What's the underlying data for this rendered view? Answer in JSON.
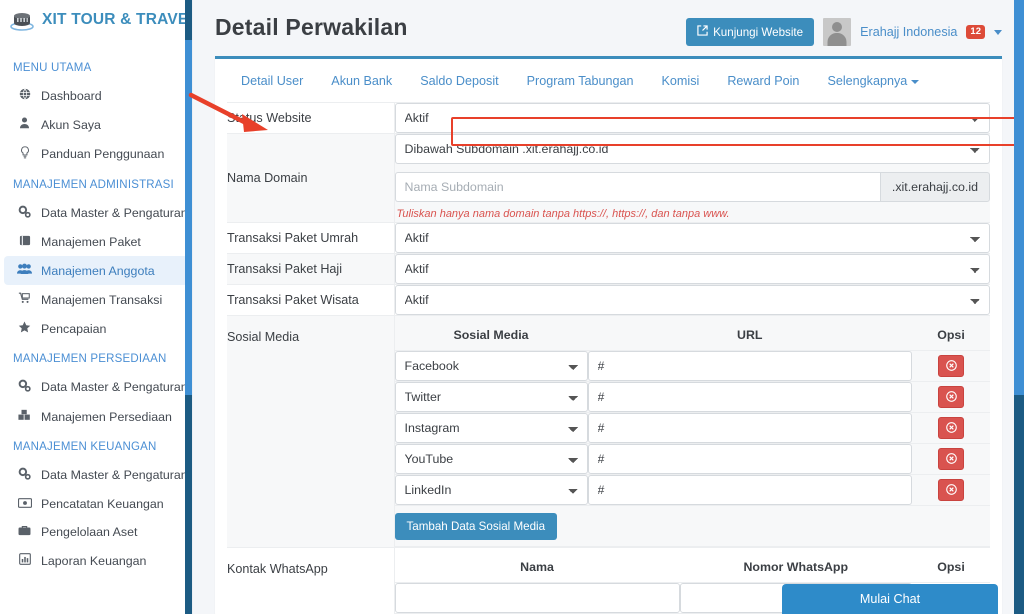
{
  "brand": {
    "name": "XIT TOUR & TRAVEL",
    "logo_icon": "stack-logo-icon"
  },
  "sidebar": {
    "groups": [
      {
        "header": "MENU UTAMA",
        "items": [
          {
            "label": "Dashboard",
            "icon": "globe-icon",
            "active": false
          },
          {
            "label": "Akun Saya",
            "icon": "user-icon",
            "active": false
          },
          {
            "label": "Panduan Penggunaan",
            "icon": "lightbulb-icon",
            "active": false
          }
        ]
      },
      {
        "header": "MANAJEMEN ADMINISTRASI",
        "items": [
          {
            "label": "Data Master & Pengaturan",
            "icon": "gears-icon",
            "active": false
          },
          {
            "label": "Manajemen Paket",
            "icon": "book-icon",
            "active": false
          },
          {
            "label": "Manajemen Anggota",
            "icon": "users-icon",
            "active": true
          },
          {
            "label": "Manajemen Transaksi",
            "icon": "cart-icon",
            "active": false
          },
          {
            "label": "Pencapaian",
            "icon": "star-icon",
            "active": false
          }
        ]
      },
      {
        "header": "MANAJEMEN PERSEDIAAN",
        "items": [
          {
            "label": "Data Master & Pengaturan",
            "icon": "gears-icon",
            "active": false
          },
          {
            "label": "Manajemen Persediaan",
            "icon": "boxes-icon",
            "active": false
          }
        ]
      },
      {
        "header": "MANAJEMEN KEUANGAN",
        "items": [
          {
            "label": "Data Master & Pengaturan",
            "icon": "gears-icon",
            "active": false
          },
          {
            "label": "Pencatatan Keuangan",
            "icon": "money-icon",
            "active": false
          },
          {
            "label": "Pengelolaan Aset",
            "icon": "briefcase-icon",
            "active": false
          },
          {
            "label": "Laporan Keuangan",
            "icon": "report-icon",
            "active": false
          }
        ]
      }
    ]
  },
  "header": {
    "page_title": "Detail Perwakilan",
    "visit_button": "Kunjungi Website",
    "visit_icon": "external-link-icon",
    "user_name": "Erahajj Indonesia",
    "notification_count": "12",
    "caret_icon": "chevron-down-icon"
  },
  "tabs": [
    {
      "label": "Detail User"
    },
    {
      "label": "Akun Bank"
    },
    {
      "label": "Saldo Deposit"
    },
    {
      "label": "Program Tabungan"
    },
    {
      "label": "Komisi"
    },
    {
      "label": "Reward Poin"
    },
    {
      "label": "Selengkapnya",
      "has_caret": true
    }
  ],
  "form": {
    "status_website": {
      "label": "Status Website",
      "value": "Aktif"
    },
    "nama_domain": {
      "label": "Nama Domain",
      "select_value": "Dibawah Subdomain .xit.erahajj.co.id",
      "input_placeholder": "Nama Subdomain",
      "input_value": "",
      "addon": ".xit.erahajj.co.id",
      "help": "Tuliskan hanya nama domain tanpa https://, https://, dan tanpa www."
    },
    "transaksi_umrah": {
      "label": "Transaksi Paket Umrah",
      "value": "Aktif"
    },
    "transaksi_haji": {
      "label": "Transaksi Paket Haji",
      "value": "Aktif"
    },
    "transaksi_wisata": {
      "label": "Transaksi Paket Wisata",
      "value": "Aktif"
    },
    "sosial_media": {
      "label": "Sosial Media",
      "columns": [
        "Sosial Media",
        "URL",
        "Opsi"
      ],
      "rows": [
        {
          "platform": "Facebook",
          "url": "#"
        },
        {
          "platform": "Twitter",
          "url": "#"
        },
        {
          "platform": "Instagram",
          "url": "#"
        },
        {
          "platform": "YouTube",
          "url": "#"
        },
        {
          "platform": "LinkedIn",
          "url": "#"
        }
      ],
      "add_button": "Tambah Data Sosial Media",
      "delete_icon": "remove-circle-icon"
    },
    "kontak_whatsapp": {
      "label": "Kontak WhatsApp",
      "columns": [
        "Nama",
        "Nomor WhatsApp",
        "Opsi"
      ]
    }
  },
  "chat_widget": {
    "label": "Mulai Chat"
  },
  "colors": {
    "brand_blue": "#3c8dbc",
    "sidebar_link": "#4b8fd4",
    "highlight_red": "#e8402a",
    "danger_red": "#d9534f",
    "badge_red": "#dd4b39"
  }
}
